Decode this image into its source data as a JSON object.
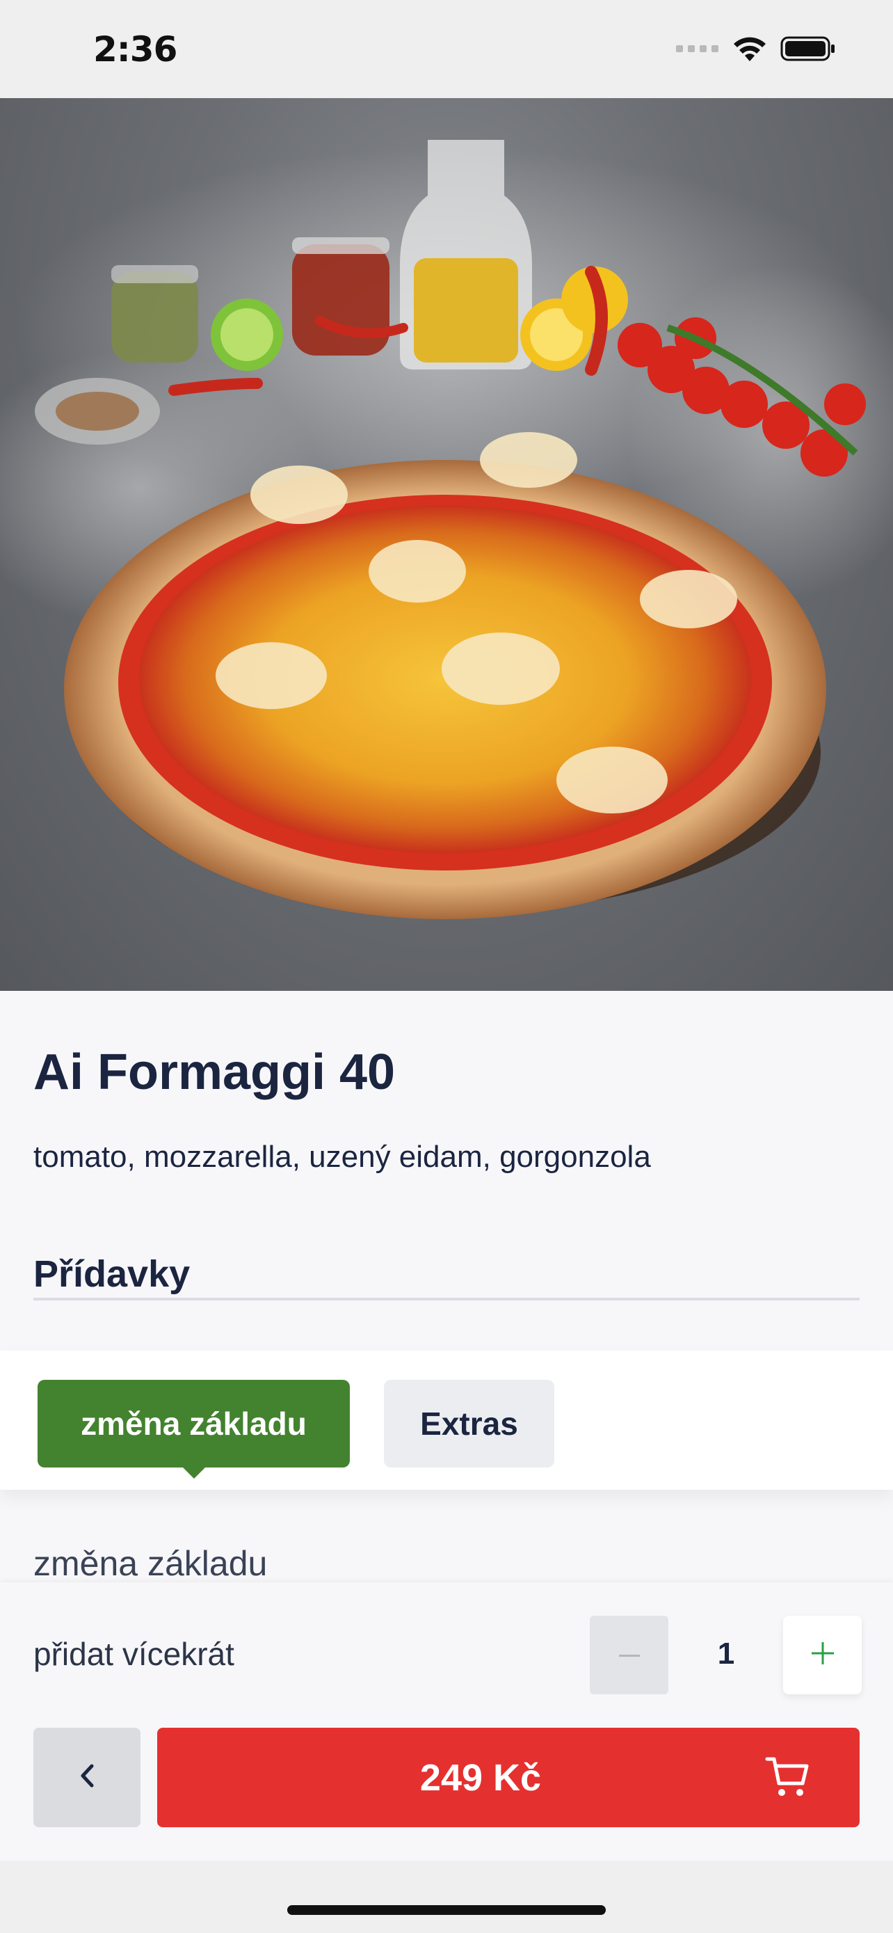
{
  "status_bar": {
    "time": "2:36",
    "icons": [
      "signal-icon",
      "wifi-icon",
      "battery-icon"
    ]
  },
  "hero": {
    "image_alt": "pizza-photo"
  },
  "product": {
    "title": "Ai Formaggi 40",
    "description": "tomato, mozzarella, uzený eidam, gorgonzola"
  },
  "addons": {
    "heading": "Přídavky",
    "tabs": [
      {
        "label": "změna základu",
        "active": true
      },
      {
        "label": "Extras",
        "active": false
      }
    ],
    "group_label": "změna základu"
  },
  "quantity": {
    "label": "přidat vícekrát",
    "value": "1",
    "minus_icon": "minus-icon",
    "plus_icon": "plus-icon"
  },
  "actions": {
    "back_icon": "chevron-left-icon",
    "price": "249 Kč",
    "cart_icon": "cart-icon"
  },
  "colors": {
    "accent_green": "#43822f",
    "cta_red": "#e53030",
    "text_dark": "#1b2540"
  }
}
